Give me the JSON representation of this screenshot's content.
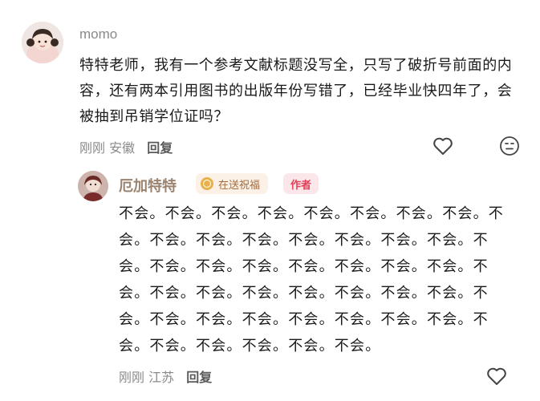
{
  "comment": {
    "username": "momo",
    "text": "特特老师，我有一个参考文献标题没写全，只写了破折号前面的内容，还有两本引用图书的出版年份写错了，已经毕业快四年了，会被抽到吊销学位证吗？",
    "time": "刚刚",
    "location": "安徽",
    "reply_label": "回复",
    "like_icon": "heart-outline-icon",
    "emoji_icon": "smiley-icon"
  },
  "reply": {
    "username": "厄加特特",
    "bless_badge": "在送祝福",
    "author_badge": "作者",
    "text": "不会。不会。不会。不会。不会。不会。不会。不会。不会。不会。不会。不会。不会。不会。不会。不会。不会。不会。不会。不会。不会。不会。不会。不会。不会。不会。不会。不会。不会。不会。不会。不会。不会。不会。不会。不会。不会。不会。不会。不会。不会。不会。不会。不会。不会。不会。",
    "time": "刚刚",
    "location": "江苏",
    "reply_label": "回复",
    "like_icon": "heart-outline-icon"
  },
  "colors": {
    "author_badge": "#e33f56",
    "bless_badge": "#a66a3a",
    "meta_text": "#8a8a8a"
  }
}
